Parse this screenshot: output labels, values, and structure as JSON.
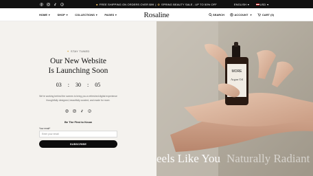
{
  "announcement": {
    "promo_text": "FREE SHIPPING ON ORDERS OVER $99",
    "separator": "|",
    "sale_text": "SPRING BEAUTY SALE - UP TO 50% OFF",
    "language": "ENGLISH",
    "currency": "USD",
    "social_icons": [
      "facebook-icon",
      "instagram-icon",
      "tiktok-icon",
      "pinterest-icon"
    ]
  },
  "header": {
    "logo": "Rosaline",
    "nav": [
      {
        "label": "HOME"
      },
      {
        "label": "SHOP"
      },
      {
        "label": "COLLECTIONS"
      },
      {
        "label": "PAGES"
      }
    ],
    "search_label": "SEARCH",
    "account_label": "ACCOUNT",
    "cart_label": "CART (0)"
  },
  "hero": {
    "eyebrow": "STAY TUNED",
    "title_line1": "Our New Website",
    "title_line2": "Is Launching Soon",
    "countdown": {
      "hours": "03",
      "minutes": "30",
      "seconds": "05",
      "sep": ":"
    },
    "description_line1": "We're working behind the scenes to bring you a refreshed digital experience",
    "description_line2": "thoughtfully designed, beautifully curated, and made for more.",
    "social_icons": [
      "facebook-icon",
      "instagram-icon",
      "tiktok-icon",
      "pinterest-icon"
    ],
    "signup_title": "Be The First to Know",
    "email_label": "Your email*",
    "email_placeholder": "Enter your email",
    "subscribe_label": "SUBSCRIBE"
  },
  "image_panel": {
    "product_brand": "MORE",
    "product_name": "Argan Oil",
    "marquee_1": "eels Like You",
    "marquee_2": "Naturally Radiant"
  },
  "colors": {
    "topbar_bg": "#111111",
    "hero_bg": "#f4f2ee",
    "button_bg": "#0d0d0d",
    "accent_dot": "#d9a73b"
  }
}
